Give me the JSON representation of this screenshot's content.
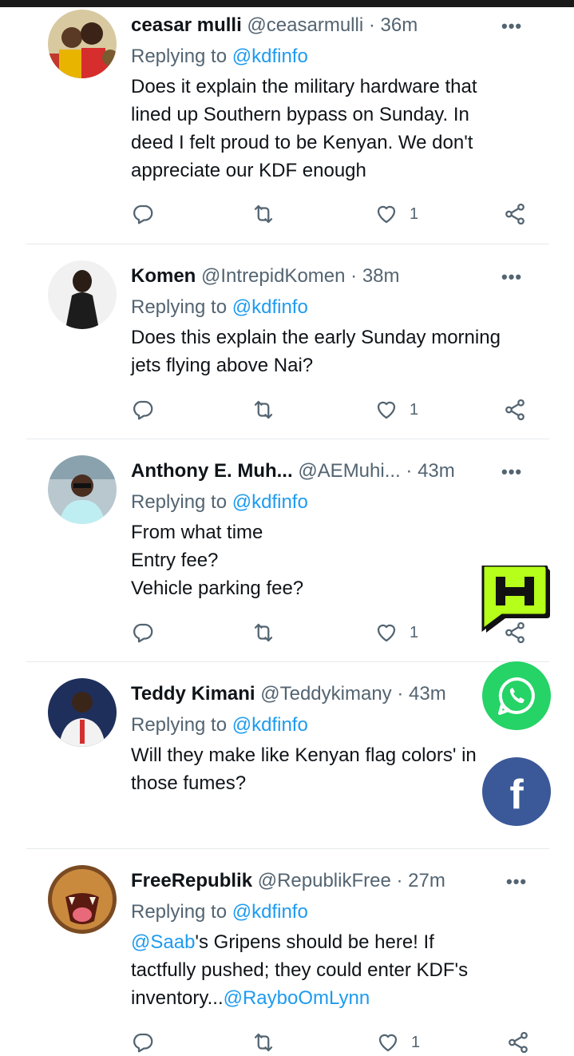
{
  "tweets": [
    {
      "name": "ceasar mulli",
      "handle": "@ceasarmulli",
      "sep": "·",
      "time": "36m",
      "replying_prefix": "Replying to ",
      "replying_handle": "@kdfinfo",
      "body_lines": [
        "Does it explain the military hardware that",
        "lined up Southern bypass on Sunday. In",
        "deed I felt proud to be Kenyan. We don't",
        "appreciate our KDF enough"
      ],
      "likes": "1"
    },
    {
      "name": "Komen",
      "handle": "@IntrepidKomen",
      "sep": "·",
      "time": "38m",
      "replying_prefix": "Replying to ",
      "replying_handle": "@kdfinfo",
      "body_lines": [
        "Does this explain the early Sunday morning",
        "jets flying above Nai?"
      ],
      "likes": "1"
    },
    {
      "name": "Anthony E. Muh...",
      "handle": "@AEMuhi...",
      "sep": "·",
      "time": "43m",
      "replying_prefix": "Replying to ",
      "replying_handle": "@kdfinfo",
      "body_lines": [
        "From what time",
        "Entry fee?",
        "Vehicle parking fee?"
      ],
      "likes": "1"
    },
    {
      "name": "Teddy Kimani",
      "handle": "@Teddykimany",
      "sep": "·",
      "time": "43m",
      "replying_prefix": "Replying to ",
      "replying_handle": "@kdfinfo",
      "body_lines": [
        "Will they make like Kenyan flag colors' in",
        "those fumes?"
      ]
    },
    {
      "name": "FreeRepublik",
      "handle": "@RepublikFree",
      "sep": "·",
      "time": "27m",
      "replying_prefix": "Replying to ",
      "replying_handle": "@kdfinfo",
      "body_line1_mention": "@Saab",
      "body_line1_rest": "'s Gripens should be here! If",
      "body_line2": "tactfully pushed; they could enter KDF's",
      "body_line3_text": "inventory...",
      "body_line3_mention": "@RayboOmLynn",
      "likes": "1"
    }
  ],
  "more_glyph": "•••",
  "overlay": {
    "logo_letter": "H",
    "whatsapp_icon": "whatsapp-icon",
    "facebook_icon": "facebook-icon",
    "facebook_letter": "f"
  },
  "colors": {
    "link": "#1d9bf0",
    "secondary": "#536471",
    "whatsapp": "#25d366",
    "facebook": "#3b5998",
    "logo_green": "#b5ff1a"
  }
}
